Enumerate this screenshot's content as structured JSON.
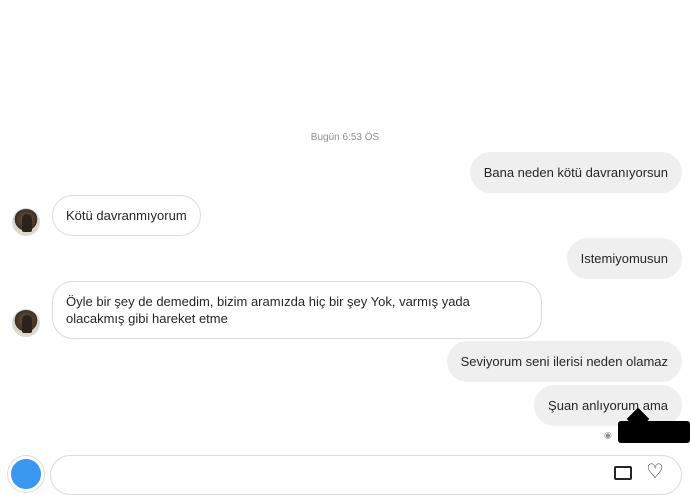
{
  "thread": {
    "timestamp": "Bugün 6:53 ÖS",
    "messages": [
      {
        "direction": "out",
        "text": "Bana neden kötü davranıyorsun"
      },
      {
        "direction": "in",
        "text": "Kötü davranmıyorum"
      },
      {
        "direction": "out",
        "text": "Istemiyomusun"
      },
      {
        "direction": "in",
        "text": "Öyle bir şey de demedim, bizim aramızda hiç bir şey Yok, varmış yada olacakmış gibi hareket etme"
      },
      {
        "direction": "out",
        "text": "Seviyorum seni ilerisi neden olamaz"
      },
      {
        "direction": "out",
        "text": "Şuan anlıyorum ama"
      }
    ]
  },
  "composer": {
    "icons": [
      "camera-icon",
      "gallery-icon",
      "heart-icon"
    ],
    "seen_icon": "eye-icon"
  },
  "colors": {
    "outgoing_bubble": "#efefef",
    "incoming_border": "#dbdbdb",
    "timestamp_text": "#8e8e8e",
    "camera_button": "#3897f0"
  }
}
